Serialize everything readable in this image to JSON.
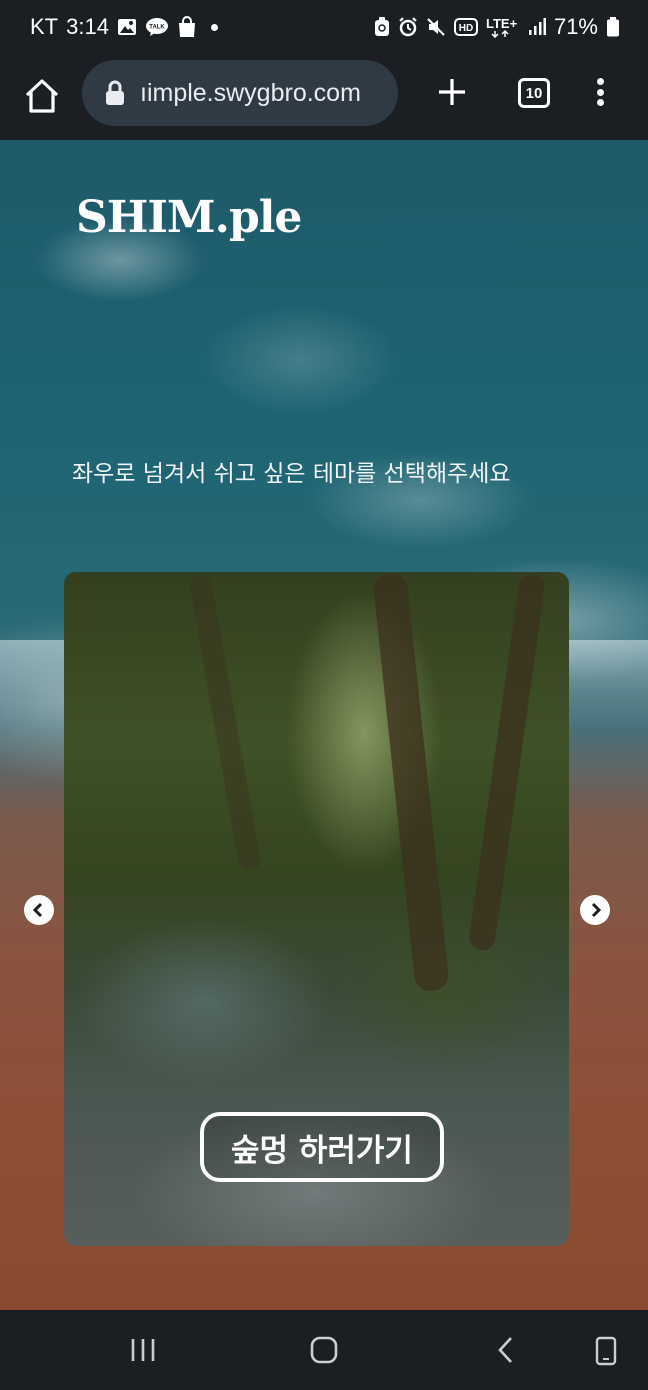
{
  "status_bar": {
    "carrier": "KT",
    "time": "3:14",
    "battery": "71%",
    "left_icons": [
      "gallery-icon",
      "talk-icon",
      "shopping-bag-icon",
      "dot-icon"
    ],
    "right_icons": [
      "recycle-icon",
      "alarm-icon",
      "mute-icon",
      "hd-icon",
      "lte-plus-icon",
      "signal-icon",
      "battery-icon"
    ],
    "hd_label": "HD",
    "network_label": "LTE+",
    "talk_label": "TALK"
  },
  "browser": {
    "url": "ıimple.swygbro.com",
    "tab_count": "10"
  },
  "page": {
    "logo": "SHIM.ple",
    "instruction": "좌우로 넘겨서 쉬고 싶은 테마를 선택해주세요",
    "card": {
      "theme": "forest",
      "cta_label": "숲멍 하러가기"
    }
  },
  "colors": {
    "system_bar": "#1b1f24",
    "url_pill": "#2f3a44",
    "ocean": "#1d6473",
    "sand": "#8b4a30",
    "forest": "#3f5126"
  }
}
